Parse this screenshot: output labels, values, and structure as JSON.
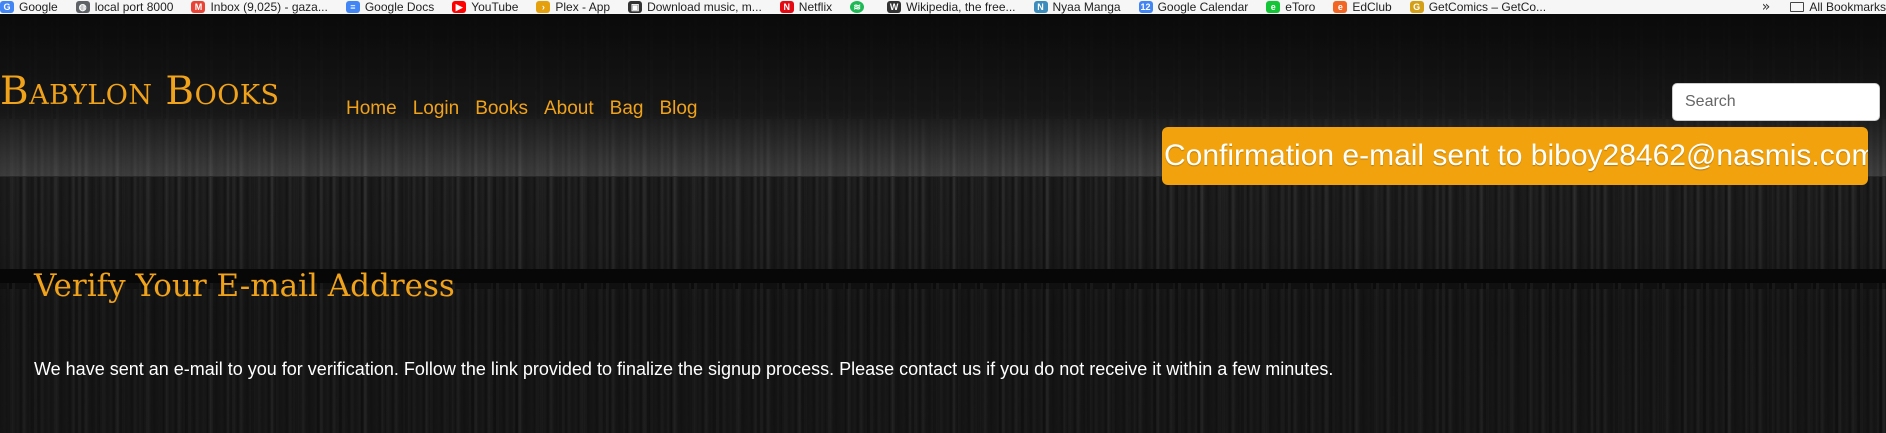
{
  "bookmarks": {
    "items": [
      {
        "label": "Google",
        "icon": "google-icon",
        "color": "#4285f4",
        "glyph": "G"
      },
      {
        "label": "local port 8000",
        "icon": "globe-icon",
        "color": "#5f6368",
        "glyph": "◍"
      },
      {
        "label": "Inbox (9,025) - gaza...",
        "icon": "gmail-icon",
        "color": "#ea4335",
        "glyph": "M"
      },
      {
        "label": "Google Docs",
        "icon": "docs-icon",
        "color": "#4285f4",
        "glyph": "≡"
      },
      {
        "label": "YouTube",
        "icon": "youtube-icon",
        "color": "#ff0000",
        "glyph": "▶"
      },
      {
        "label": "Plex - App",
        "icon": "plex-icon",
        "color": "#e5a00d",
        "glyph": "›"
      },
      {
        "label": "Download music, m...",
        "icon": "download-icon",
        "color": "#333333",
        "glyph": "▣"
      },
      {
        "label": "Netflix",
        "icon": "netflix-icon",
        "color": "#e50914",
        "glyph": "N"
      },
      {
        "label": "",
        "icon": "spotify-icon",
        "color": "#1db954",
        "glyph": "≋"
      },
      {
        "label": "Wikipedia, the free...",
        "icon": "wikipedia-icon",
        "color": "#333333",
        "glyph": "W"
      },
      {
        "label": "Nyaa Manga",
        "icon": "nyaa-icon",
        "color": "#3c8dbc",
        "glyph": "N"
      },
      {
        "label": "Google Calendar",
        "icon": "calendar-icon",
        "color": "#4285f4",
        "glyph": "12"
      },
      {
        "label": "eToro",
        "icon": "etoro-icon",
        "color": "#13c636",
        "glyph": "e"
      },
      {
        "label": "EdClub",
        "icon": "edclub-icon",
        "color": "#f26522",
        "glyph": "e"
      },
      {
        "label": "GetComics – GetCo...",
        "icon": "getcomics-icon",
        "color": "#d4a017",
        "glyph": "G"
      }
    ],
    "overflow_glyph": "»",
    "all_bookmarks_label": "All Bookmarks"
  },
  "header": {
    "brand": "Babylon Books",
    "nav": [
      "Home",
      "Login",
      "Books",
      "About",
      "Bag",
      "Blog"
    ],
    "search_placeholder": "Search"
  },
  "toast": {
    "message": "Confirmation e-mail sent to biboy28462@nasmis.com."
  },
  "content": {
    "title": "Verify Your E-mail Address",
    "message": "We have sent an e-mail to you for verification. Follow the link provided to finalize the signup process. Please contact us if you do not receive it within a few minutes."
  },
  "colors": {
    "accent": "#f0a21a",
    "toast_bg": "#f2a20c",
    "text": "#ffffff"
  }
}
